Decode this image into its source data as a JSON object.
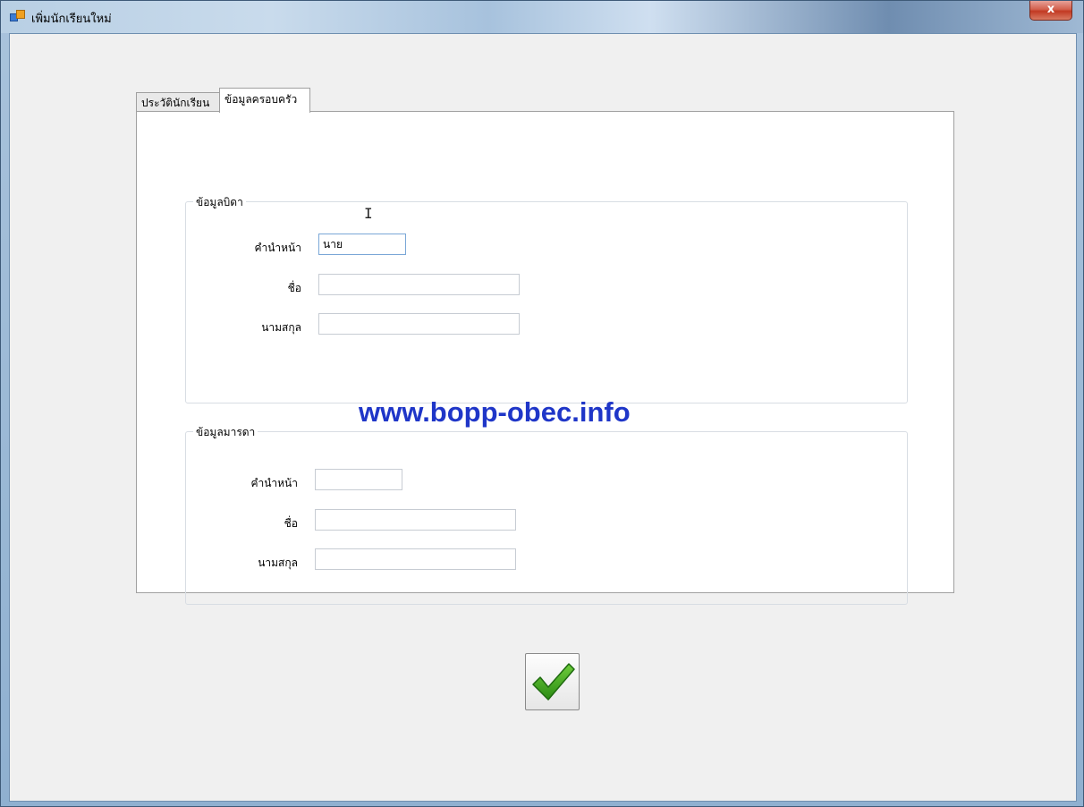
{
  "window": {
    "title": "เพิ่มนักเรียนใหม่",
    "close_label": "x"
  },
  "tabs": [
    {
      "label": "ประวัตินักเรียน"
    },
    {
      "label": "ข้อมูลครอบครัว"
    }
  ],
  "father": {
    "title": "ข้อมูลบิดา",
    "prefix_label": "คำนำหน้า",
    "prefix_value": "นาย",
    "firstname_label": "ชื่อ",
    "firstname_value": "",
    "lastname_label": "นามสกุล",
    "lastname_value": ""
  },
  "mother": {
    "title": "ข้อมูลมารดา",
    "prefix_label": "คำนำหน้า",
    "prefix_value": "",
    "firstname_label": "ชื่อ",
    "firstname_value": "",
    "lastname_label": "นามสกุล",
    "lastname_value": ""
  },
  "watermark": "www.bopp-obec.info",
  "colors": {
    "accent_check": "#3a9a1e",
    "watermark": "#1f36c8"
  },
  "icons": {
    "confirm": "checkmark-icon",
    "cursor": "text-cursor-icon"
  }
}
